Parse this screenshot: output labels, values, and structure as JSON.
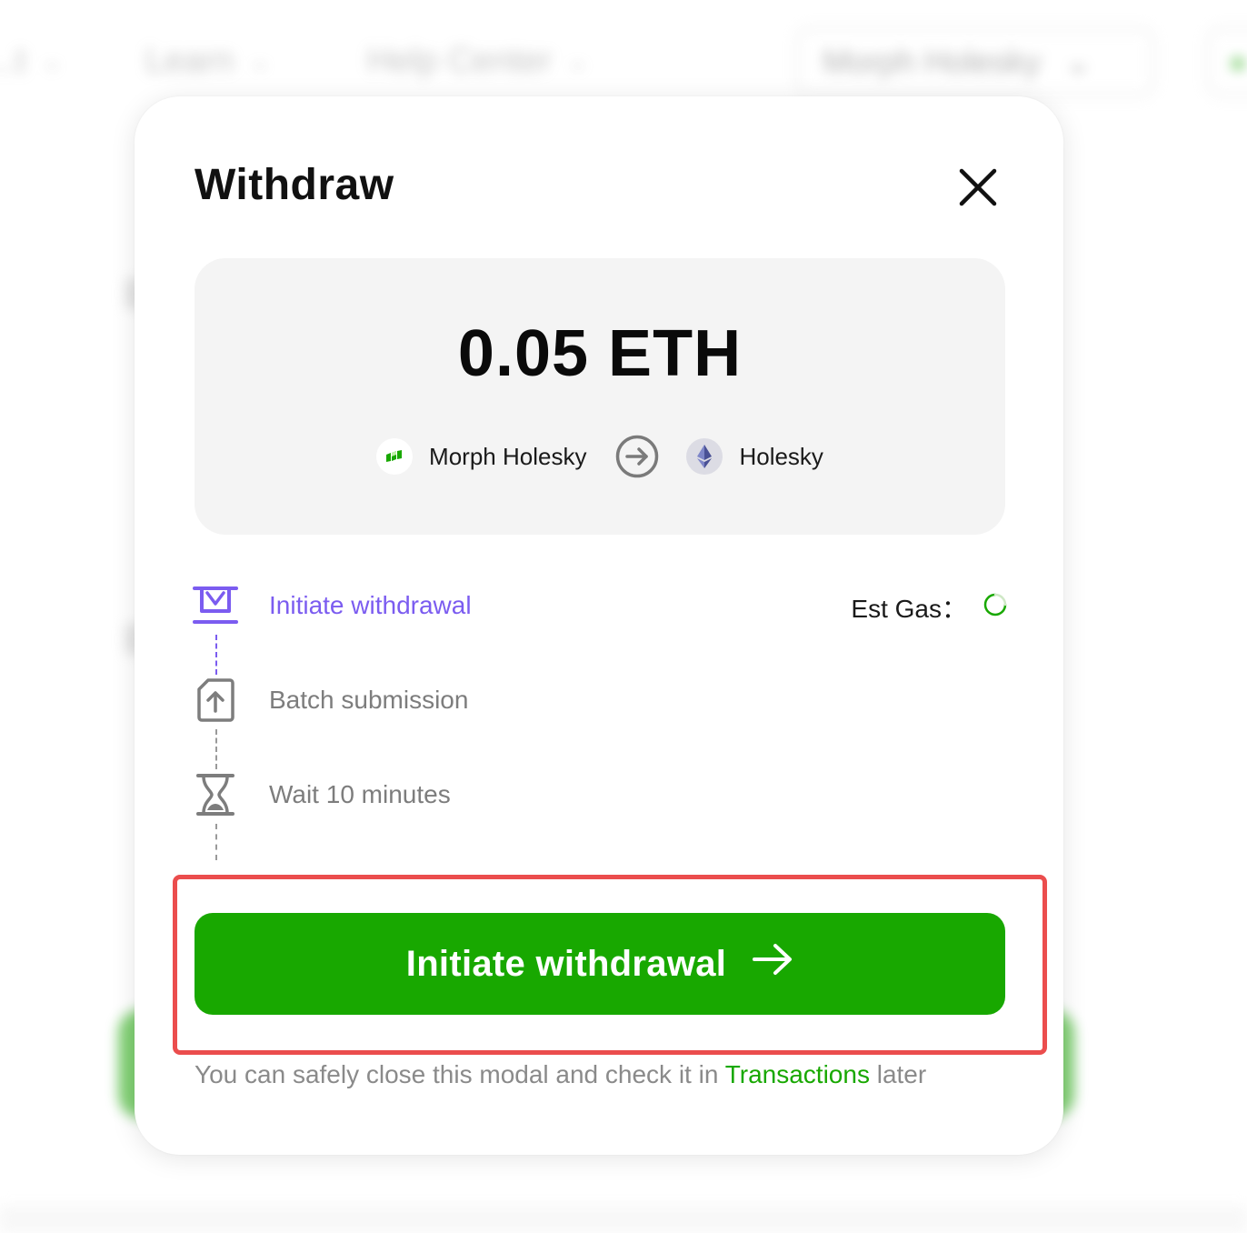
{
  "background": {
    "nav_items": [
      {
        "label": "...t"
      },
      {
        "label": "Learn"
      },
      {
        "label": "Help Center"
      }
    ],
    "network_selector": "Morph Holesky"
  },
  "modal": {
    "title": "Withdraw",
    "amount": "0.05 ETH",
    "from_chain": "Morph Holesky",
    "to_chain": "Holesky",
    "steps": [
      {
        "label": "Initiate withdrawal",
        "state": "active",
        "icon": "withdraw-tray-icon"
      },
      {
        "label": "Batch submission",
        "state": "pending",
        "icon": "file-upload-icon"
      },
      {
        "label": "Wait 10 minutes",
        "state": "pending",
        "icon": "hourglass-icon"
      }
    ],
    "est_gas_label": "Est Gas：",
    "primary_button_label": "Initiate withdrawal",
    "note_prefix": "You can safely close this modal and check it in ",
    "note_link": "Transactions",
    "note_suffix": " later"
  },
  "colors": {
    "accent_green": "#18a800",
    "active_purple": "#7b5cf0",
    "highlight_red": "#eb4d4d"
  }
}
